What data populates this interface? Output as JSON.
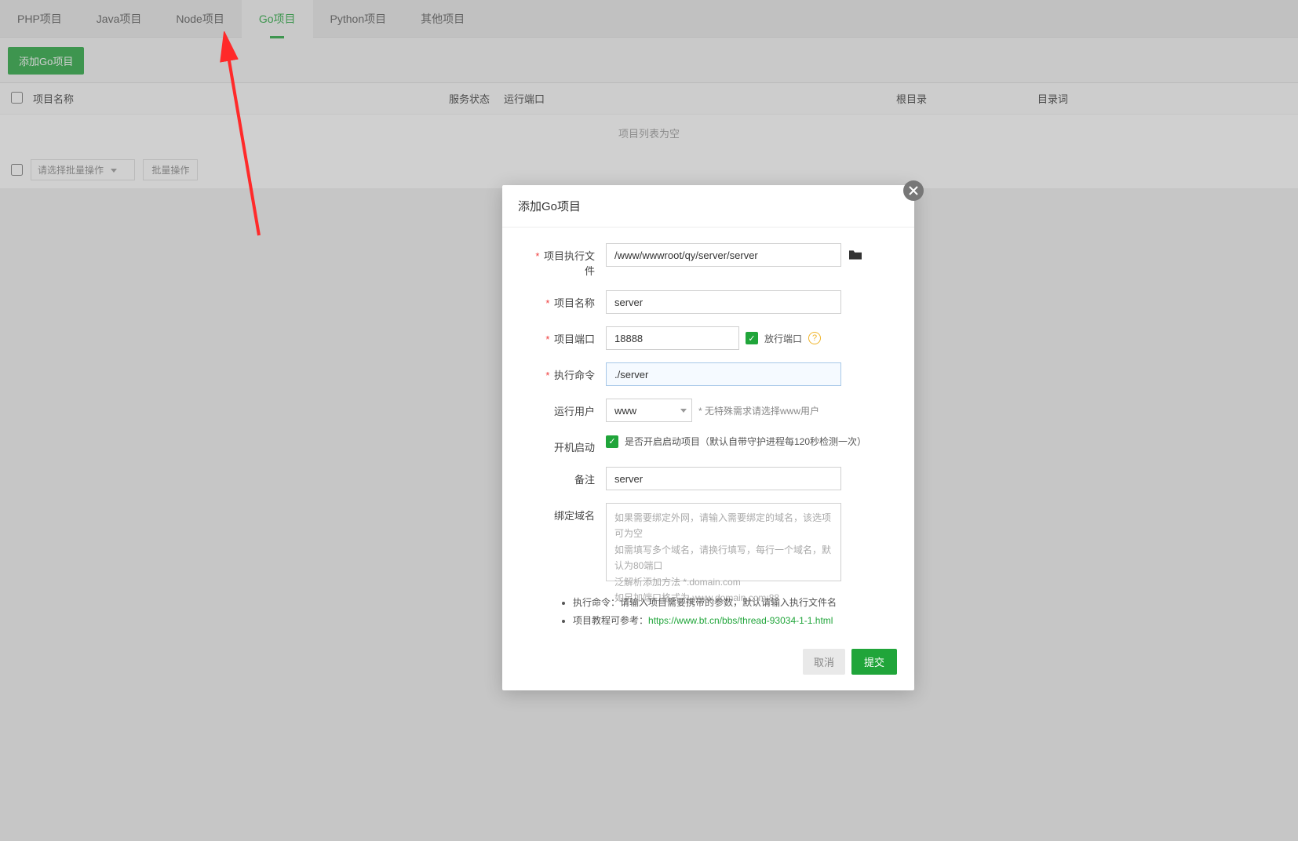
{
  "tabs": [
    {
      "label": "PHP项目",
      "active": false
    },
    {
      "label": "Java项目",
      "active": false
    },
    {
      "label": "Node项目",
      "active": false
    },
    {
      "label": "Go项目",
      "active": true
    },
    {
      "label": "Python项目",
      "active": false
    },
    {
      "label": "其他项目",
      "active": false
    }
  ],
  "toolbar": {
    "add_button": "添加Go项目"
  },
  "table": {
    "headers": {
      "name": "项目名称",
      "status": "服务状态",
      "port": "运行端口",
      "root": "根目录",
      "dir": "目录词"
    },
    "empty": "项目列表为空"
  },
  "bulk": {
    "select_placeholder": "请选择批量操作",
    "action_button": "批量操作"
  },
  "modal": {
    "title": "添加Go项目",
    "fields": {
      "exec_file": {
        "label": "项目执行文件",
        "value": "/www/wwwroot/qy/server/server"
      },
      "name": {
        "label": "项目名称",
        "value": "server"
      },
      "port": {
        "label": "项目端口",
        "value": "18888",
        "release_port": "放行端口"
      },
      "cmd": {
        "label": "执行命令",
        "value": "./server"
      },
      "user": {
        "label": "运行用户",
        "value": "www",
        "hint": "* 无特殊需求请选择www用户"
      },
      "autostart": {
        "label": "开机启动",
        "desc": "是否开启启动项目（默认自带守护进程每120秒检测一次）"
      },
      "remark": {
        "label": "备注",
        "value": "server"
      },
      "domain": {
        "label": "绑定域名",
        "placeholder": "如果需要绑定外网，请输入需要绑定的域名，该选项可为空\n如需填写多个域名，请换行填写，每行一个域名，默认为80端口\n泛解析添加方法 *.domain.com\n如另加端口格式为 www.domain.com:88"
      }
    },
    "notes": {
      "line1": "执行命令：请输入项目需要携带的参数，默认请输入执行文件名",
      "line2_prefix": "项目教程可参考：",
      "line2_link": "https://www.bt.cn/bbs/thread-93034-1-1.html"
    },
    "footer": {
      "cancel": "取消",
      "submit": "提交"
    }
  }
}
